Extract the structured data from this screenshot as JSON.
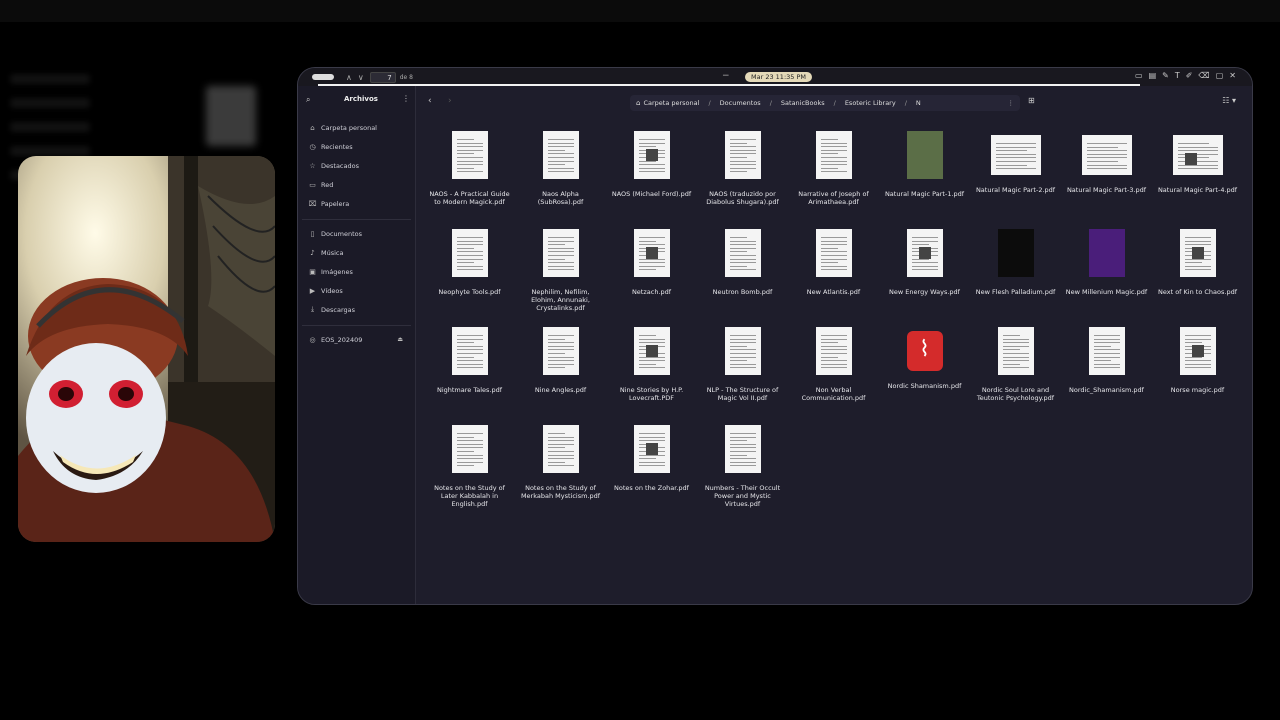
{
  "viewer_toolbar": {
    "page_number": "7",
    "page_total": "de 8",
    "datetime": "Mar 23  11:35 PM"
  },
  "sidebar": {
    "title": "Archivos",
    "items": [
      {
        "label": "Carpeta personal",
        "icon": "home-icon"
      },
      {
        "label": "Recientes",
        "icon": "clock-icon"
      },
      {
        "label": "Destacados",
        "icon": "star-icon"
      },
      {
        "label": "Red",
        "icon": "network-icon"
      },
      {
        "label": "Papelera",
        "icon": "trash-icon"
      },
      {
        "label": "Documentos",
        "icon": "document-icon"
      },
      {
        "label": "Música",
        "icon": "music-icon"
      },
      {
        "label": "Imágenes",
        "icon": "image-icon"
      },
      {
        "label": "Vídeos",
        "icon": "video-icon"
      },
      {
        "label": "Descargas",
        "icon": "download-icon"
      },
      {
        "label": "EOS_202409",
        "icon": "disc-icon"
      }
    ]
  },
  "breadcrumb": [
    "Carpeta personal",
    "Documentos",
    "SatanicBooks",
    "Esoteric Library",
    "N"
  ],
  "files": [
    {
      "name": "NAOS - A Practical Guide to Modern Magick.pdf",
      "thumb": "doc"
    },
    {
      "name": "Naos Alpha (SubRosa).pdf",
      "thumb": "doc"
    },
    {
      "name": "NAOS (Michael Ford).pdf",
      "thumb": "doc"
    },
    {
      "name": "NAOS (traduzido por Diabolus Shugara).pdf",
      "thumb": "doc"
    },
    {
      "name": "Narrative of Joseph of Arimathaea.pdf",
      "thumb": "doc"
    },
    {
      "name": "Natural Magic Part-1.pdf",
      "thumb": "green"
    },
    {
      "name": "Natural Magic Part-2.pdf",
      "thumb": "wide"
    },
    {
      "name": "Natural Magic Part-3.pdf",
      "thumb": "wide"
    },
    {
      "name": "Natural Magic Part-4.pdf",
      "thumb": "wide"
    },
    {
      "name": "Neophyte Tools.pdf",
      "thumb": "doc"
    },
    {
      "name": "Nephilim, Nefilim, Elohim, Annunaki, Crystalinks.pdf",
      "thumb": "doc"
    },
    {
      "name": "Netzach.pdf",
      "thumb": "doc"
    },
    {
      "name": "Neutron Bomb.pdf",
      "thumb": "doc"
    },
    {
      "name": "New Atlantis.pdf",
      "thumb": "doc"
    },
    {
      "name": "New Energy Ways.pdf",
      "thumb": "doc"
    },
    {
      "name": "New Flesh Palladium.pdf",
      "thumb": "dark"
    },
    {
      "name": "New Millenium Magic.pdf",
      "thumb": "purple"
    },
    {
      "name": "Next of Kin to Chaos.pdf",
      "thumb": "doc"
    },
    {
      "name": "Nightmare Tales.pdf",
      "thumb": "doc"
    },
    {
      "name": "Nine Angles.pdf",
      "thumb": "doc"
    },
    {
      "name": "Nine Stories by H.P. Lovecraft.PDF",
      "thumb": "doc"
    },
    {
      "name": "NLP - The Structure of Magic Vol II.pdf",
      "thumb": "doc"
    },
    {
      "name": "Non Verbal Communication.pdf",
      "thumb": "doc"
    },
    {
      "name": "Nordic Shamanism.pdf",
      "thumb": "pdficon"
    },
    {
      "name": "Nordic Soul Lore and Teutonic Psychology.pdf",
      "thumb": "doc"
    },
    {
      "name": "Nordic_Shamanism.pdf",
      "thumb": "doc"
    },
    {
      "name": "Norse magic.pdf",
      "thumb": "doc"
    },
    {
      "name": "Notes on the Study of Later Kabbalah in English.pdf",
      "thumb": "doc"
    },
    {
      "name": "Notes on the Study of Merkabah Mysticism.pdf",
      "thumb": "doc"
    },
    {
      "name": "Notes on the Zohar.pdf",
      "thumb": "doc"
    },
    {
      "name": "Numbers - Their Occult Power and Mystic Virtues.pdf",
      "thumb": "doc"
    }
  ],
  "colors": {
    "window_bg": "#1e1d2b",
    "sidebar_bg": "#1b1a27",
    "pdf_red": "#d42b2b"
  }
}
